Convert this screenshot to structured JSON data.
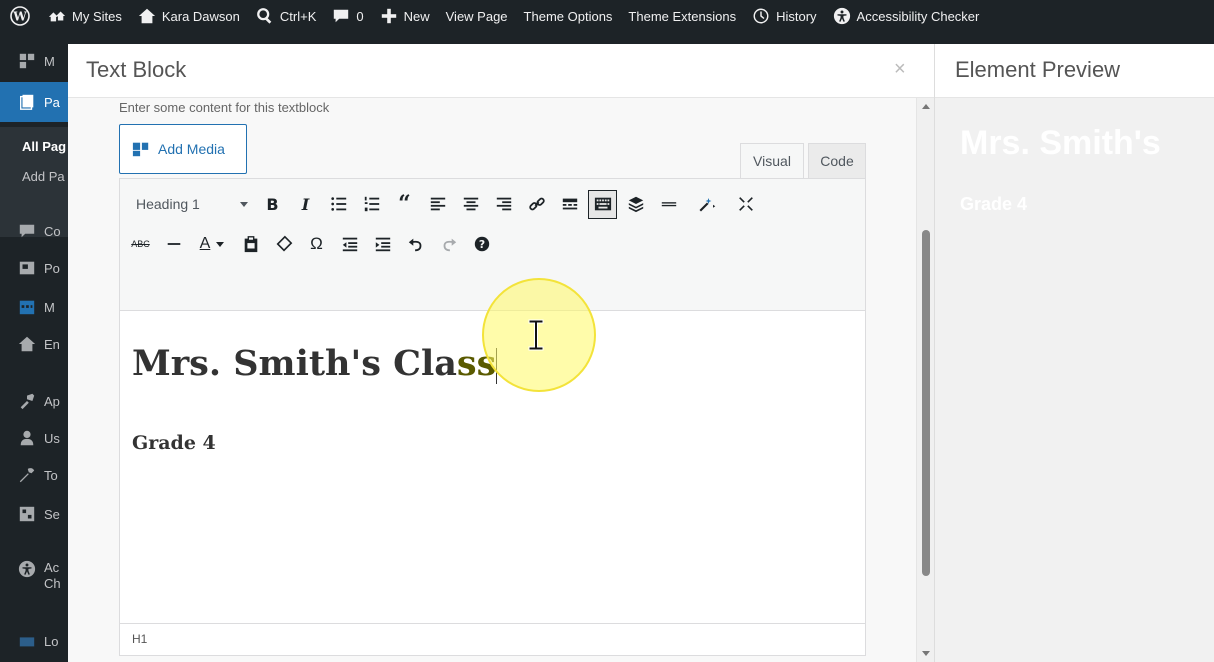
{
  "adminbar": {
    "my_sites": "My Sites",
    "site_name": "Kara Dawson",
    "search": "Ctrl+K",
    "comments_count": "0",
    "new": "New",
    "view_page": "View Page",
    "theme_options": "Theme Options",
    "theme_extensions": "Theme Extensions",
    "history": "History",
    "accessibility_checker": "Accessibility Checker"
  },
  "sidebar": {
    "items": [
      {
        "label": "M",
        "icon": "media-icon"
      },
      {
        "label": "Pa",
        "icon": "pages-icon"
      },
      {
        "label": "Co",
        "icon": "comments-icon"
      },
      {
        "label": "Po",
        "icon": "portfolio-icon"
      },
      {
        "label": "M",
        "icon": "calendar-icon"
      },
      {
        "label": "En",
        "icon": "enfold-icon"
      },
      {
        "label": "Ap",
        "icon": "appearance-icon"
      },
      {
        "label": "Us",
        "icon": "users-icon"
      },
      {
        "label": "To",
        "icon": "tools-icon"
      },
      {
        "label": "Se",
        "icon": "settings-icon"
      },
      {
        "label": "Ac",
        "label2": "Ch",
        "icon": "accessibility-icon"
      },
      {
        "label": "Lo",
        "icon": "layout-icon"
      }
    ],
    "submenu": {
      "all_pages": "All Pag",
      "add_page": "Add Pa"
    }
  },
  "modal": {
    "title": "Text Block",
    "close_glyph": "×",
    "description": "Enter some content for this textblock",
    "add_media": "Add Media",
    "tab_visual": "Visual",
    "tab_code": "Code",
    "format_select": "Heading 1",
    "content_h1_before": "Mrs. Smith's Cla",
    "content_h1_selected": "ss",
    "content_p": "Grade 4",
    "status_path": "H1"
  },
  "preview": {
    "title": "Element Preview",
    "h1": "Mrs. Smith's",
    "p": "Grade 4"
  },
  "colors": {
    "adminbar_bg": "#1d2327",
    "accent_blue": "#2271b1",
    "cursor_highlight": "#fff36b"
  }
}
